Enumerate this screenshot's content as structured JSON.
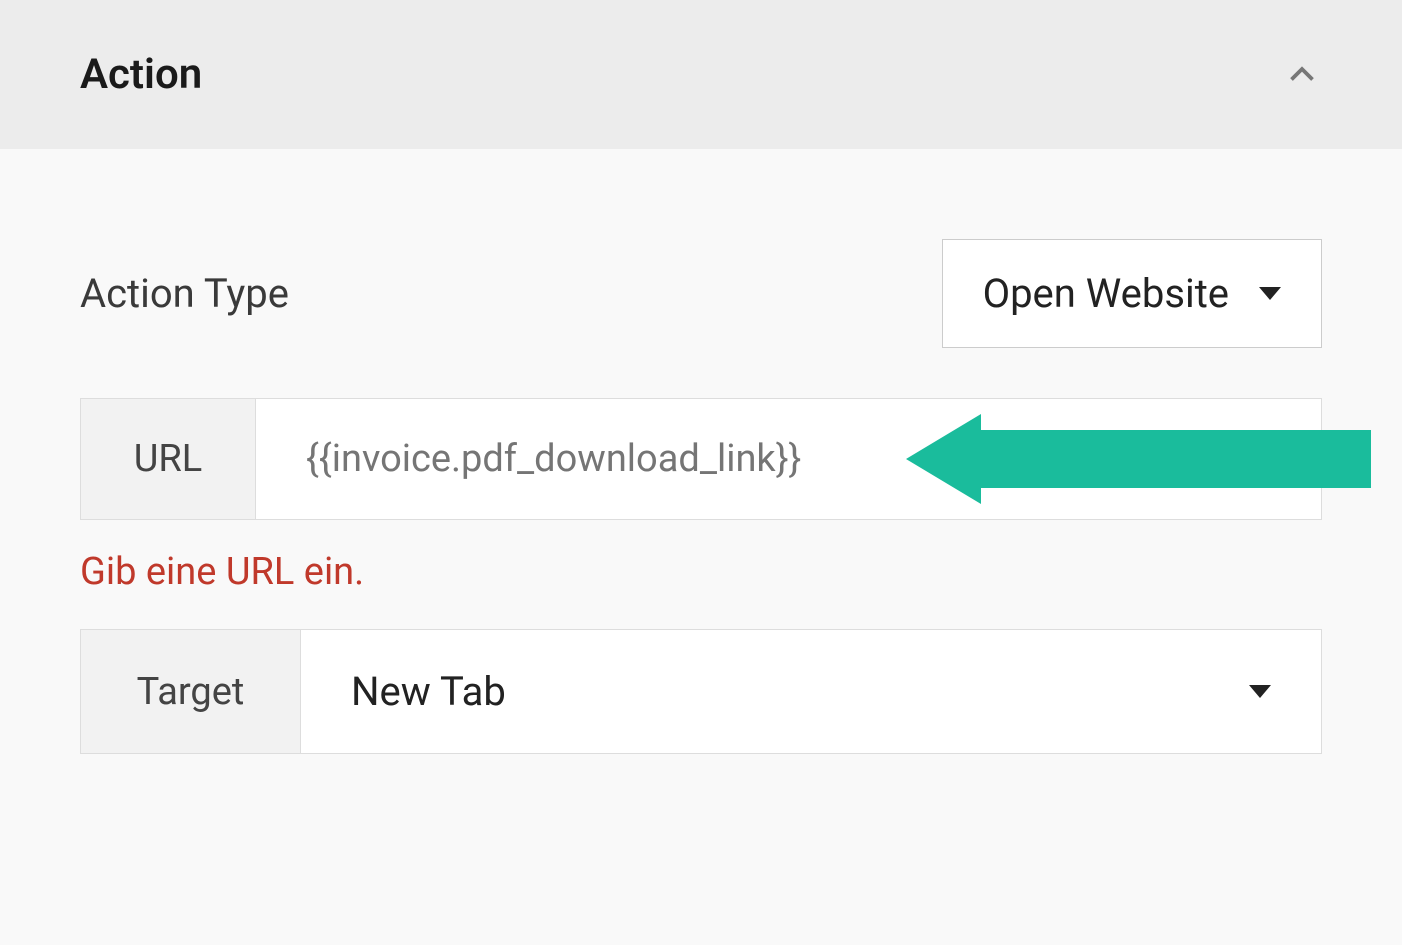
{
  "accordion": {
    "title": "Action"
  },
  "fields": {
    "action_type": {
      "label": "Action Type",
      "value": "Open Website"
    },
    "url": {
      "label": "URL",
      "placeholder": "{{invoice.pdf_download_link}}",
      "error": "Gib eine URL ein."
    },
    "target": {
      "label": "Target",
      "value": "New Tab"
    }
  }
}
